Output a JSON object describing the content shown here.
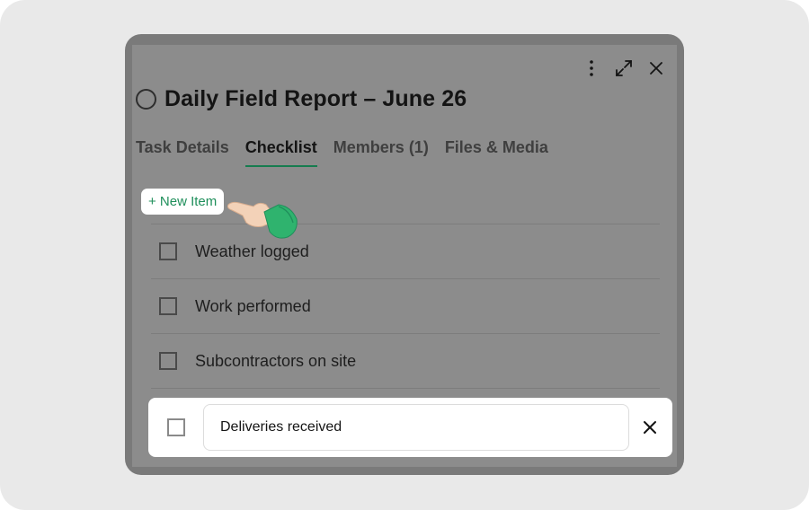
{
  "modal": {
    "title": "Daily Field Report – June 26",
    "actions": [
      {
        "icon": "more-vertical-icon"
      },
      {
        "icon": "expand-icon"
      },
      {
        "icon": "close-icon"
      }
    ]
  },
  "tabs": [
    {
      "label": "Task Details",
      "active": false
    },
    {
      "label": "Checklist",
      "active": true
    },
    {
      "label": "Members (1)",
      "active": false
    },
    {
      "label": "Files & Media",
      "active": false
    }
  ],
  "checklist": {
    "new_item_label": "+ New Item",
    "items": [
      {
        "label": "Weather logged",
        "checked": false
      },
      {
        "label": "Work performed",
        "checked": false
      },
      {
        "label": "Subcontractors on site",
        "checked": false
      }
    ],
    "editing": {
      "value": "Deliveries received",
      "checked": false
    }
  },
  "colors": {
    "accent": "#167c4f",
    "accent_text": "#1f8f5b",
    "overlay": "#8c8c8c"
  }
}
